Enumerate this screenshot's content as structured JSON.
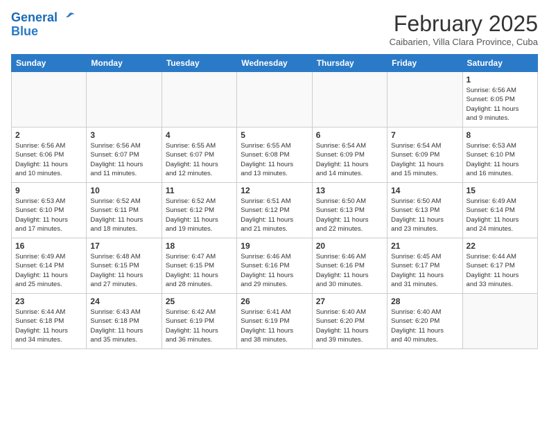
{
  "header": {
    "logo_line1": "General",
    "logo_line2": "Blue",
    "month": "February 2025",
    "location": "Caibarien, Villa Clara Province, Cuba"
  },
  "weekdays": [
    "Sunday",
    "Monday",
    "Tuesday",
    "Wednesday",
    "Thursday",
    "Friday",
    "Saturday"
  ],
  "weeks": [
    [
      {
        "day": "",
        "info": ""
      },
      {
        "day": "",
        "info": ""
      },
      {
        "day": "",
        "info": ""
      },
      {
        "day": "",
        "info": ""
      },
      {
        "day": "",
        "info": ""
      },
      {
        "day": "",
        "info": ""
      },
      {
        "day": "1",
        "info": "Sunrise: 6:56 AM\nSunset: 6:05 PM\nDaylight: 11 hours\nand 9 minutes."
      }
    ],
    [
      {
        "day": "2",
        "info": "Sunrise: 6:56 AM\nSunset: 6:06 PM\nDaylight: 11 hours\nand 10 minutes."
      },
      {
        "day": "3",
        "info": "Sunrise: 6:56 AM\nSunset: 6:07 PM\nDaylight: 11 hours\nand 11 minutes."
      },
      {
        "day": "4",
        "info": "Sunrise: 6:55 AM\nSunset: 6:07 PM\nDaylight: 11 hours\nand 12 minutes."
      },
      {
        "day": "5",
        "info": "Sunrise: 6:55 AM\nSunset: 6:08 PM\nDaylight: 11 hours\nand 13 minutes."
      },
      {
        "day": "6",
        "info": "Sunrise: 6:54 AM\nSunset: 6:09 PM\nDaylight: 11 hours\nand 14 minutes."
      },
      {
        "day": "7",
        "info": "Sunrise: 6:54 AM\nSunset: 6:09 PM\nDaylight: 11 hours\nand 15 minutes."
      },
      {
        "day": "8",
        "info": "Sunrise: 6:53 AM\nSunset: 6:10 PM\nDaylight: 11 hours\nand 16 minutes."
      }
    ],
    [
      {
        "day": "9",
        "info": "Sunrise: 6:53 AM\nSunset: 6:10 PM\nDaylight: 11 hours\nand 17 minutes."
      },
      {
        "day": "10",
        "info": "Sunrise: 6:52 AM\nSunset: 6:11 PM\nDaylight: 11 hours\nand 18 minutes."
      },
      {
        "day": "11",
        "info": "Sunrise: 6:52 AM\nSunset: 6:12 PM\nDaylight: 11 hours\nand 19 minutes."
      },
      {
        "day": "12",
        "info": "Sunrise: 6:51 AM\nSunset: 6:12 PM\nDaylight: 11 hours\nand 21 minutes."
      },
      {
        "day": "13",
        "info": "Sunrise: 6:50 AM\nSunset: 6:13 PM\nDaylight: 11 hours\nand 22 minutes."
      },
      {
        "day": "14",
        "info": "Sunrise: 6:50 AM\nSunset: 6:13 PM\nDaylight: 11 hours\nand 23 minutes."
      },
      {
        "day": "15",
        "info": "Sunrise: 6:49 AM\nSunset: 6:14 PM\nDaylight: 11 hours\nand 24 minutes."
      }
    ],
    [
      {
        "day": "16",
        "info": "Sunrise: 6:49 AM\nSunset: 6:14 PM\nDaylight: 11 hours\nand 25 minutes."
      },
      {
        "day": "17",
        "info": "Sunrise: 6:48 AM\nSunset: 6:15 PM\nDaylight: 11 hours\nand 27 minutes."
      },
      {
        "day": "18",
        "info": "Sunrise: 6:47 AM\nSunset: 6:15 PM\nDaylight: 11 hours\nand 28 minutes."
      },
      {
        "day": "19",
        "info": "Sunrise: 6:46 AM\nSunset: 6:16 PM\nDaylight: 11 hours\nand 29 minutes."
      },
      {
        "day": "20",
        "info": "Sunrise: 6:46 AM\nSunset: 6:16 PM\nDaylight: 11 hours\nand 30 minutes."
      },
      {
        "day": "21",
        "info": "Sunrise: 6:45 AM\nSunset: 6:17 PM\nDaylight: 11 hours\nand 31 minutes."
      },
      {
        "day": "22",
        "info": "Sunrise: 6:44 AM\nSunset: 6:17 PM\nDaylight: 11 hours\nand 33 minutes."
      }
    ],
    [
      {
        "day": "23",
        "info": "Sunrise: 6:44 AM\nSunset: 6:18 PM\nDaylight: 11 hours\nand 34 minutes."
      },
      {
        "day": "24",
        "info": "Sunrise: 6:43 AM\nSunset: 6:18 PM\nDaylight: 11 hours\nand 35 minutes."
      },
      {
        "day": "25",
        "info": "Sunrise: 6:42 AM\nSunset: 6:19 PM\nDaylight: 11 hours\nand 36 minutes."
      },
      {
        "day": "26",
        "info": "Sunrise: 6:41 AM\nSunset: 6:19 PM\nDaylight: 11 hours\nand 38 minutes."
      },
      {
        "day": "27",
        "info": "Sunrise: 6:40 AM\nSunset: 6:20 PM\nDaylight: 11 hours\nand 39 minutes."
      },
      {
        "day": "28",
        "info": "Sunrise: 6:40 AM\nSunset: 6:20 PM\nDaylight: 11 hours\nand 40 minutes."
      },
      {
        "day": "",
        "info": ""
      }
    ]
  ]
}
